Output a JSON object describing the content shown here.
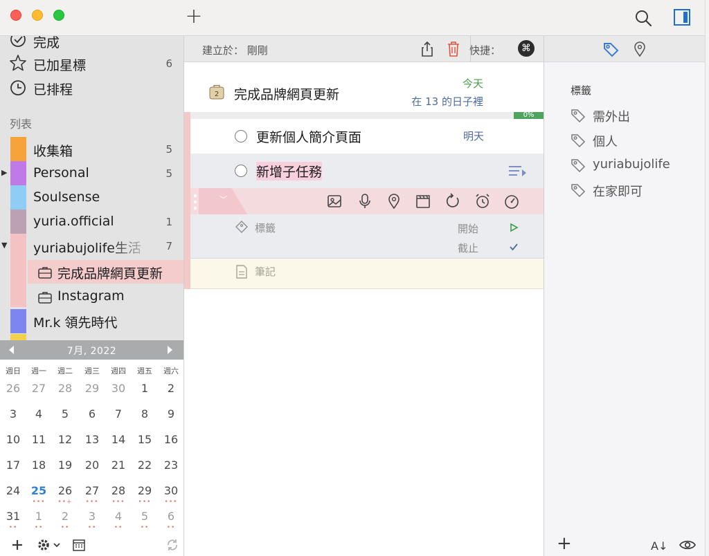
{
  "toolbar": {
    "add_label": "+",
    "search_icon": "search-icon",
    "sidebar_icon": "sidebar-toggle-icon"
  },
  "sidebar": {
    "smart_lists": [
      {
        "label": "完成",
        "count": ""
      },
      {
        "label": "已加星標",
        "count": "6"
      },
      {
        "label": "已排程",
        "count": ""
      }
    ],
    "section_title": "列表",
    "lists": [
      {
        "label": "收集箱",
        "count": "5",
        "color": "#f6a33b"
      },
      {
        "label": "Personal",
        "count": "5",
        "color": "#c07ae8"
      },
      {
        "label": "Soulsense",
        "count": "",
        "color": "#8fcdf4"
      },
      {
        "label": "yuria.official",
        "count": "1",
        "color": "#bca1b3"
      },
      {
        "label": "yuriabujolife生活",
        "count": "7",
        "color": "#f4c2c2"
      },
      {
        "label": "Mr.k 領先時代",
        "count": "",
        "color": "#7d86f0"
      }
    ],
    "projects": [
      {
        "label": "完成品牌網頁更新"
      },
      {
        "label": "Instagram"
      }
    ]
  },
  "calendar": {
    "title": "7月, 2022",
    "weekdays": [
      "週日",
      "週一",
      "週二",
      "週三",
      "週四",
      "週五",
      "週六"
    ],
    "rows": [
      [
        "26",
        "27",
        "28",
        "29",
        "30",
        "1",
        "2"
      ],
      [
        "3",
        "4",
        "5",
        "6",
        "7",
        "8",
        "9"
      ],
      [
        "10",
        "11",
        "12",
        "13",
        "14",
        "15",
        "16"
      ],
      [
        "17",
        "18",
        "19",
        "20",
        "21",
        "22",
        "23"
      ],
      [
        "24",
        "25",
        "26",
        "27",
        "28",
        "29",
        "30"
      ],
      [
        "31",
        "1",
        "2",
        "3",
        "4",
        "5",
        "6"
      ]
    ],
    "dots_row5": [
      "",
      "•••",
      "••+",
      "•••",
      "•••",
      "•••",
      "•••"
    ],
    "dots_row6": [
      "••",
      "••",
      "••",
      "••",
      "••",
      "••",
      "••"
    ]
  },
  "task": {
    "created_label": "建立於：",
    "created_value": "剛剛",
    "shortcut_label": "快捷：",
    "shortcut_key": "⌘",
    "project_badge": "2",
    "title": "完成品牌網頁更新",
    "due_label": "今天",
    "days_label": "在 13 的日子裡",
    "progress_label": "0%",
    "progress": 0,
    "subtasks": [
      {
        "title": "更新個人簡介頁面",
        "due": "明天"
      },
      {
        "title": "新增子任務",
        "due": ""
      }
    ],
    "tags_field": "標籤",
    "start_label": "開始",
    "end_label": "截止",
    "notes_placeholder": "筆記"
  },
  "inspector": {
    "tags_title": "標籤",
    "tags": [
      "需外出",
      "個人",
      "yuriabujolife",
      "在家即可"
    ],
    "sort_label": "A↓"
  },
  "colors": {
    "accent_pink": "#f5c8c8",
    "today_blue": "#2f7fd4",
    "due_green": "#4aa04a",
    "due_blue": "#4d6aa1",
    "progress_green": "#4fa45d",
    "inspector_tag_blue": "#3a7bd5"
  }
}
